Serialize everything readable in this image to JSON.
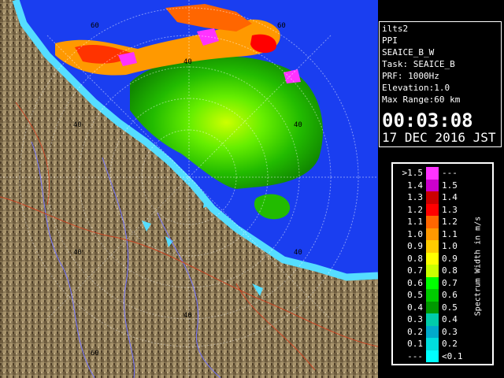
{
  "app": {
    "title": "ilts2"
  },
  "info": {
    "lines": [
      "ilts2",
      "PPI",
      "SEAICE_B_W",
      "Task: SEAICE_B",
      "PRF: 1000Hz",
      "Elevation:1.0",
      "Max Range:60 km"
    ],
    "time": "00:03:08",
    "date": "17 DEC 2016 JST"
  },
  "ring_labels": {
    "r40": "40",
    "r60": "60"
  },
  "legend": {
    "unit_label": "Spectrum Width in m/s",
    "rows": [
      {
        "left": ">1.5",
        "right": "---",
        "color": "#ff33ff"
      },
      {
        "left": "1.4",
        "right": "1.5",
        "color": "#cc00cc"
      },
      {
        "left": "1.3",
        "right": "1.4",
        "color": "#cc0000"
      },
      {
        "left": "1.2",
        "right": "1.3",
        "color": "#ff0000"
      },
      {
        "left": "1.1",
        "right": "1.2",
        "color": "#ff6600"
      },
      {
        "left": "1.0",
        "right": "1.1",
        "color": "#ff9900"
      },
      {
        "left": "0.9",
        "right": "1.0",
        "color": "#ffcc00"
      },
      {
        "left": "0.8",
        "right": "0.9",
        "color": "#ffff00"
      },
      {
        "left": "0.7",
        "right": "0.8",
        "color": "#ccff00"
      },
      {
        "left": "0.6",
        "right": "0.7",
        "color": "#00ff00"
      },
      {
        "left": "0.5",
        "right": "0.6",
        "color": "#00cc00"
      },
      {
        "left": "0.4",
        "right": "0.5",
        "color": "#009900"
      },
      {
        "left": "0.3",
        "right": "0.4",
        "color": "#00ccaa"
      },
      {
        "left": "0.2",
        "right": "0.3",
        "color": "#00aacc"
      },
      {
        "left": "0.1",
        "right": "0.2",
        "color": "#00dddd"
      },
      {
        "left": "---",
        "right": "<0.1",
        "color": "#00ffff"
      }
    ]
  },
  "colors": {
    "sea": "#1a3ef0",
    "land": "#8c7a58",
    "coast": "#55ddff"
  }
}
